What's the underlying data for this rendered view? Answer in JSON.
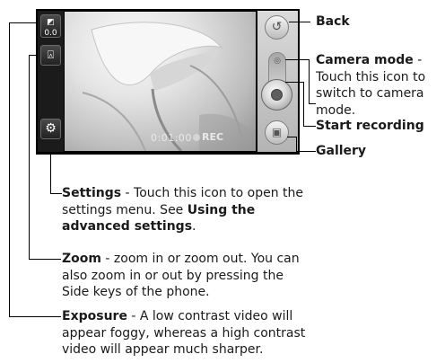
{
  "screen": {
    "exposure_value": "0.0",
    "timer": "0:01:00",
    "rec_label": "REC"
  },
  "labels": {
    "back": {
      "title": "Back",
      "desc": ""
    },
    "camera_mode": {
      "title": "Camera mode",
      "desc": " - Touch this icon to switch to camera mode."
    },
    "start_recording": {
      "title": "Start recording",
      "desc": ""
    },
    "gallery": {
      "title": "Gallery",
      "desc": ""
    },
    "settings": {
      "title": "Settings",
      "desc_1": " - Touch this icon to open the settings menu. See ",
      "link": "Using the advanced settings",
      "desc_2": "."
    },
    "zoom": {
      "title": "Zoom",
      "desc": " - zoom in or zoom out. You can also zoom in or out by pressing the Side keys of the phone."
    },
    "exposure": {
      "title": "Exposure",
      "desc": " - A low contrast video will appear foggy, whereas a high contrast video will appear much sharper."
    }
  },
  "icons": {
    "exposure": "exposure-icon",
    "zoom": "zoom-icon",
    "settings": "gear-icon",
    "back": "back-arrow-icon",
    "camera_mode": "camera-icon",
    "record": "record-button-icon",
    "gallery": "gallery-icon"
  },
  "colors": {
    "screen_bg": "#000000",
    "text": "#1a1a1a"
  }
}
